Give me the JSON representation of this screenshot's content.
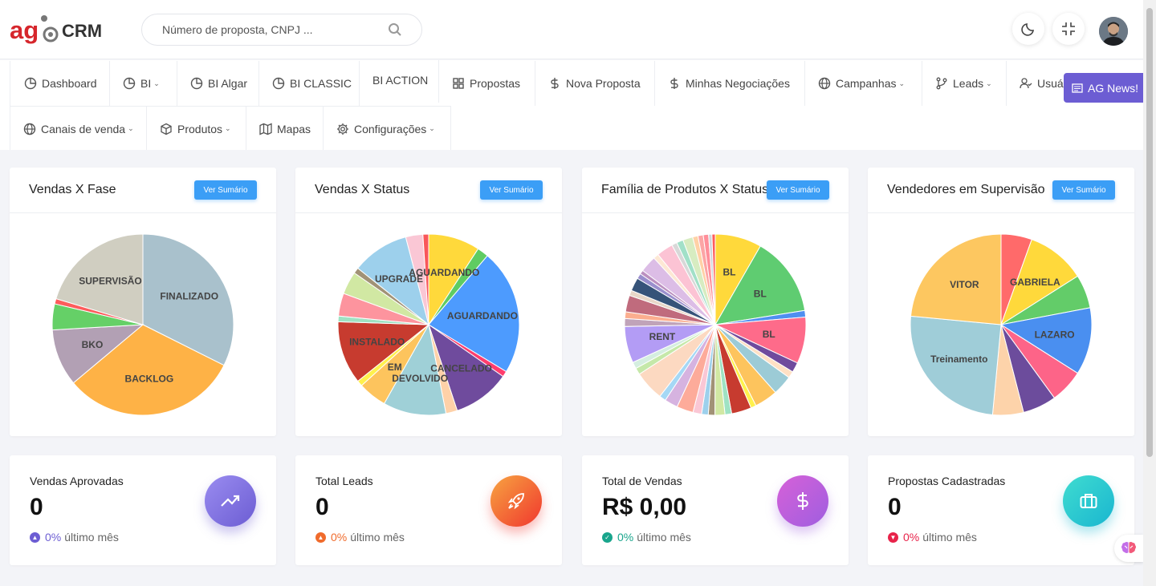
{
  "header": {
    "logo_text_ag": "ag",
    "logo_text_crm": "CRM",
    "search_placeholder": "Número de proposta, CNPJ ...",
    "theme_icon": "moon-icon",
    "fullscreen_icon": "compress-icon",
    "avatar": "user-avatar"
  },
  "nav": {
    "row1": [
      {
        "label": "Dashboard",
        "icon": "pie-icon"
      },
      {
        "label": "BI",
        "icon": "pie-icon",
        "dropdown": true
      },
      {
        "label": "BI Algar",
        "icon": "pie-icon"
      },
      {
        "label": "BI CLASSIC",
        "icon": "pie-icon"
      },
      {
        "label": "BI ACTION",
        "icon": ""
      },
      {
        "label": "Propostas",
        "icon": "grid-icon"
      },
      {
        "label": "Nova Proposta",
        "icon": "dollar-icon"
      },
      {
        "label": "Minhas Negociações",
        "icon": "dollar-icon"
      },
      {
        "label": "Campanhas",
        "icon": "globe-icon",
        "dropdown": true
      },
      {
        "label": "Leads",
        "icon": "branch-icon",
        "dropdown": true
      },
      {
        "label": "Usuá",
        "icon": "user-check-icon"
      }
    ],
    "row2": [
      {
        "label": "Canais de venda",
        "icon": "globe-icon",
        "dropdown": true
      },
      {
        "label": "Produtos",
        "icon": "box-icon",
        "dropdown": true
      },
      {
        "label": "Mapas",
        "icon": "map-icon"
      },
      {
        "label": "Configurações",
        "icon": "gear-icon",
        "dropdown": true
      }
    ],
    "ag_news": "AG News!"
  },
  "chart_cards": [
    {
      "title": "Vendas X Fase",
      "button": "Ver Sumário"
    },
    {
      "title": "Vendas X Status",
      "button": "Ver Sumário"
    },
    {
      "title": "Família de Produtos X Status",
      "button": "Ver Sumário"
    },
    {
      "title": "Vendedores em Supervisão",
      "button": "Ver Sumário"
    }
  ],
  "chart_data": [
    {
      "type": "pie",
      "title": "Vendas X Fase",
      "slices": [
        {
          "label": "FINALIZADO",
          "value": 35,
          "color": "#a9c1cc"
        },
        {
          "label": "BACKLOG",
          "value": 34,
          "color": "#feb246"
        },
        {
          "label": "BKO",
          "value": 11,
          "color": "#b2a0b4"
        },
        {
          "label": "",
          "value": 5,
          "color": "#65d067"
        },
        {
          "label": "",
          "value": 1,
          "color": "#fd5c5c"
        },
        {
          "label": "SUPERVISÃO",
          "value": 22,
          "color": "#d0cec1"
        }
      ]
    },
    {
      "type": "pie",
      "title": "Vendas X Status",
      "slices": [
        {
          "label": "AGUARDANDO",
          "value": 9,
          "color": "#ffd93b"
        },
        {
          "label": "",
          "value": 2,
          "color": "#5fcc62"
        },
        {
          "label": "AGUARDANDO",
          "value": 22,
          "color": "#4d9bfe"
        },
        {
          "label": "",
          "value": 1,
          "color": "#ff3d6e"
        },
        {
          "label": "CANCELADO",
          "value": 10,
          "color": "#6f4b9d"
        },
        {
          "label": "",
          "value": 2,
          "color": "#fed1a8"
        },
        {
          "label": "DEVOLVIDO",
          "value": 11,
          "color": "#9fd0d7"
        },
        {
          "label": "EM",
          "value": 5,
          "color": "#fdc45d"
        },
        {
          "label": "",
          "value": 1,
          "color": "#fff14d"
        },
        {
          "label": "INSTALADO",
          "value": 11,
          "color": "#c73b2f"
        },
        {
          "label": "",
          "value": 1,
          "color": "#9fe2c3"
        },
        {
          "label": "",
          "value": 4,
          "color": "#fd949e"
        },
        {
          "label": "",
          "value": 4,
          "color": "#d1e8a3"
        },
        {
          "label": "",
          "value": 1,
          "color": "#a19276"
        },
        {
          "label": "UPGRADE",
          "value": 10,
          "color": "#9dd0ec"
        },
        {
          "label": "",
          "value": 3,
          "color": "#fac7d5"
        },
        {
          "label": "",
          "value": 1,
          "color": "#f9575a"
        }
      ]
    },
    {
      "type": "pie",
      "title": "Família de Produtos X Status",
      "slices": [
        {
          "label": "BL",
          "value": 7,
          "color": "#ffd93b"
        },
        {
          "label": "BL",
          "value": 12,
          "color": "#5fcc71"
        },
        {
          "label": "",
          "value": 1,
          "color": "#4f8ff0"
        },
        {
          "label": "BL",
          "value": 7,
          "color": "#fe6b8a"
        },
        {
          "label": "",
          "value": 1.5,
          "color": "#6f4b9d"
        },
        {
          "label": "",
          "value": 1,
          "color": "#ffe0c4"
        },
        {
          "label": "",
          "value": 3,
          "color": "#9ccbd6"
        },
        {
          "label": "",
          "value": 3.5,
          "color": "#fdc45d"
        },
        {
          "label": "",
          "value": 0.8,
          "color": "#fff14d"
        },
        {
          "label": "",
          "value": 3,
          "color": "#c73b2f"
        },
        {
          "label": "",
          "value": 1,
          "color": "#9fe2c3"
        },
        {
          "label": "",
          "value": 1.5,
          "color": "#d1e8a3"
        },
        {
          "label": "",
          "value": 1,
          "color": "#a19276"
        },
        {
          "label": "",
          "value": 1,
          "color": "#9dd0ec"
        },
        {
          "label": "",
          "value": 1.3,
          "color": "#fac7d5"
        },
        {
          "label": "",
          "value": 2.5,
          "color": "#fdab9a"
        },
        {
          "label": "",
          "value": 2,
          "color": "#d6b3e0"
        },
        {
          "label": "",
          "value": 1,
          "color": "#a5d8f5"
        },
        {
          "label": "",
          "value": 4.5,
          "color": "#fcd9c1"
        },
        {
          "label": "",
          "value": 1,
          "color": "#c5e8a9"
        },
        {
          "label": "",
          "value": 1,
          "color": "#d5eee0"
        },
        {
          "label": "RENT",
          "value": 5.5,
          "color": "#b39cf5"
        },
        {
          "label": "",
          "value": 1.2,
          "color": "#c0a3b9"
        },
        {
          "label": "",
          "value": 1,
          "color": "#fbae8f"
        },
        {
          "label": "",
          "value": 2.5,
          "color": "#c06b7d"
        },
        {
          "label": "",
          "value": 0.8,
          "color": "#e8d7c8"
        },
        {
          "label": "",
          "value": 2,
          "color": "#365379"
        },
        {
          "label": "",
          "value": 0.8,
          "color": "#9a8fcd"
        },
        {
          "label": "",
          "value": 0.6,
          "color": "#bb90c0"
        },
        {
          "label": "",
          "value": 2.5,
          "color": "#dcbde6"
        },
        {
          "label": "",
          "value": 0.8,
          "color": "#fde8d4"
        },
        {
          "label": "",
          "value": 2.5,
          "color": "#fcc3d4"
        },
        {
          "label": "",
          "value": 0.8,
          "color": "#d8d8d8"
        },
        {
          "label": "",
          "value": 1,
          "color": "#a1e0c8"
        },
        {
          "label": "",
          "value": 1.5,
          "color": "#d7ecc1"
        },
        {
          "label": "",
          "value": 0.8,
          "color": "#ffd1a6"
        },
        {
          "label": "",
          "value": 0.8,
          "color": "#fca5a5"
        },
        {
          "label": "",
          "value": 0.8,
          "color": "#ff8f9a"
        },
        {
          "label": "",
          "value": 0.5,
          "color": "#cfd6dc"
        },
        {
          "label": "",
          "value": 0.5,
          "color": "#ff5b5b"
        }
      ]
    },
    {
      "type": "pie",
      "title": "Vendedores em Supervisão",
      "slices": [
        {
          "label": "",
          "value": 5.5,
          "color": "#ff6a6a"
        },
        {
          "label": "GABRIELA",
          "value": 10.5,
          "color": "#ffd93b"
        },
        {
          "label": "",
          "value": 6,
          "color": "#63cc69"
        },
        {
          "label": "LAZARO",
          "value": 12,
          "color": "#4a8ff0"
        },
        {
          "label": "",
          "value": 6,
          "color": "#fd6488"
        },
        {
          "label": "",
          "value": 6,
          "color": "#6c4c9c"
        },
        {
          "label": "",
          "value": 5.5,
          "color": "#fdd3aa"
        },
        {
          "label": "Treinamento",
          "value": 25,
          "color": "#9fcdd8"
        },
        {
          "label": "VITOR",
          "value": 23.5,
          "color": "#fdc760"
        }
      ]
    }
  ],
  "stats": [
    {
      "label": "Vendas Aprovadas",
      "value": "0",
      "delta": "0%",
      "suffix": "último mês",
      "delta_color": "#6c5dd3",
      "icon": "trending-up-icon",
      "grad": [
        "#9a8cf0",
        "#6c5dd3"
      ]
    },
    {
      "label": "Total Leads",
      "value": "0",
      "delta": "0%",
      "suffix": "último mês",
      "delta_color": "#f06b2c",
      "icon": "rocket-icon",
      "grad": [
        "#f7a441",
        "#f0372e"
      ]
    },
    {
      "label": "Total de Vendas",
      "value": "R$ 0,00",
      "delta": "0%",
      "suffix": "último mês",
      "delta_color": "#19a58c",
      "icon": "dollar-icon",
      "grad": [
        "#d661d8",
        "#9f5ee0"
      ]
    },
    {
      "label": "Propostas Cadastradas",
      "value": "0",
      "delta": "0%",
      "suffix": "último mês",
      "delta_color": "#e8234a",
      "icon": "briefcase-icon",
      "grad": [
        "#3fdcd0",
        "#1ab6d0"
      ]
    }
  ]
}
